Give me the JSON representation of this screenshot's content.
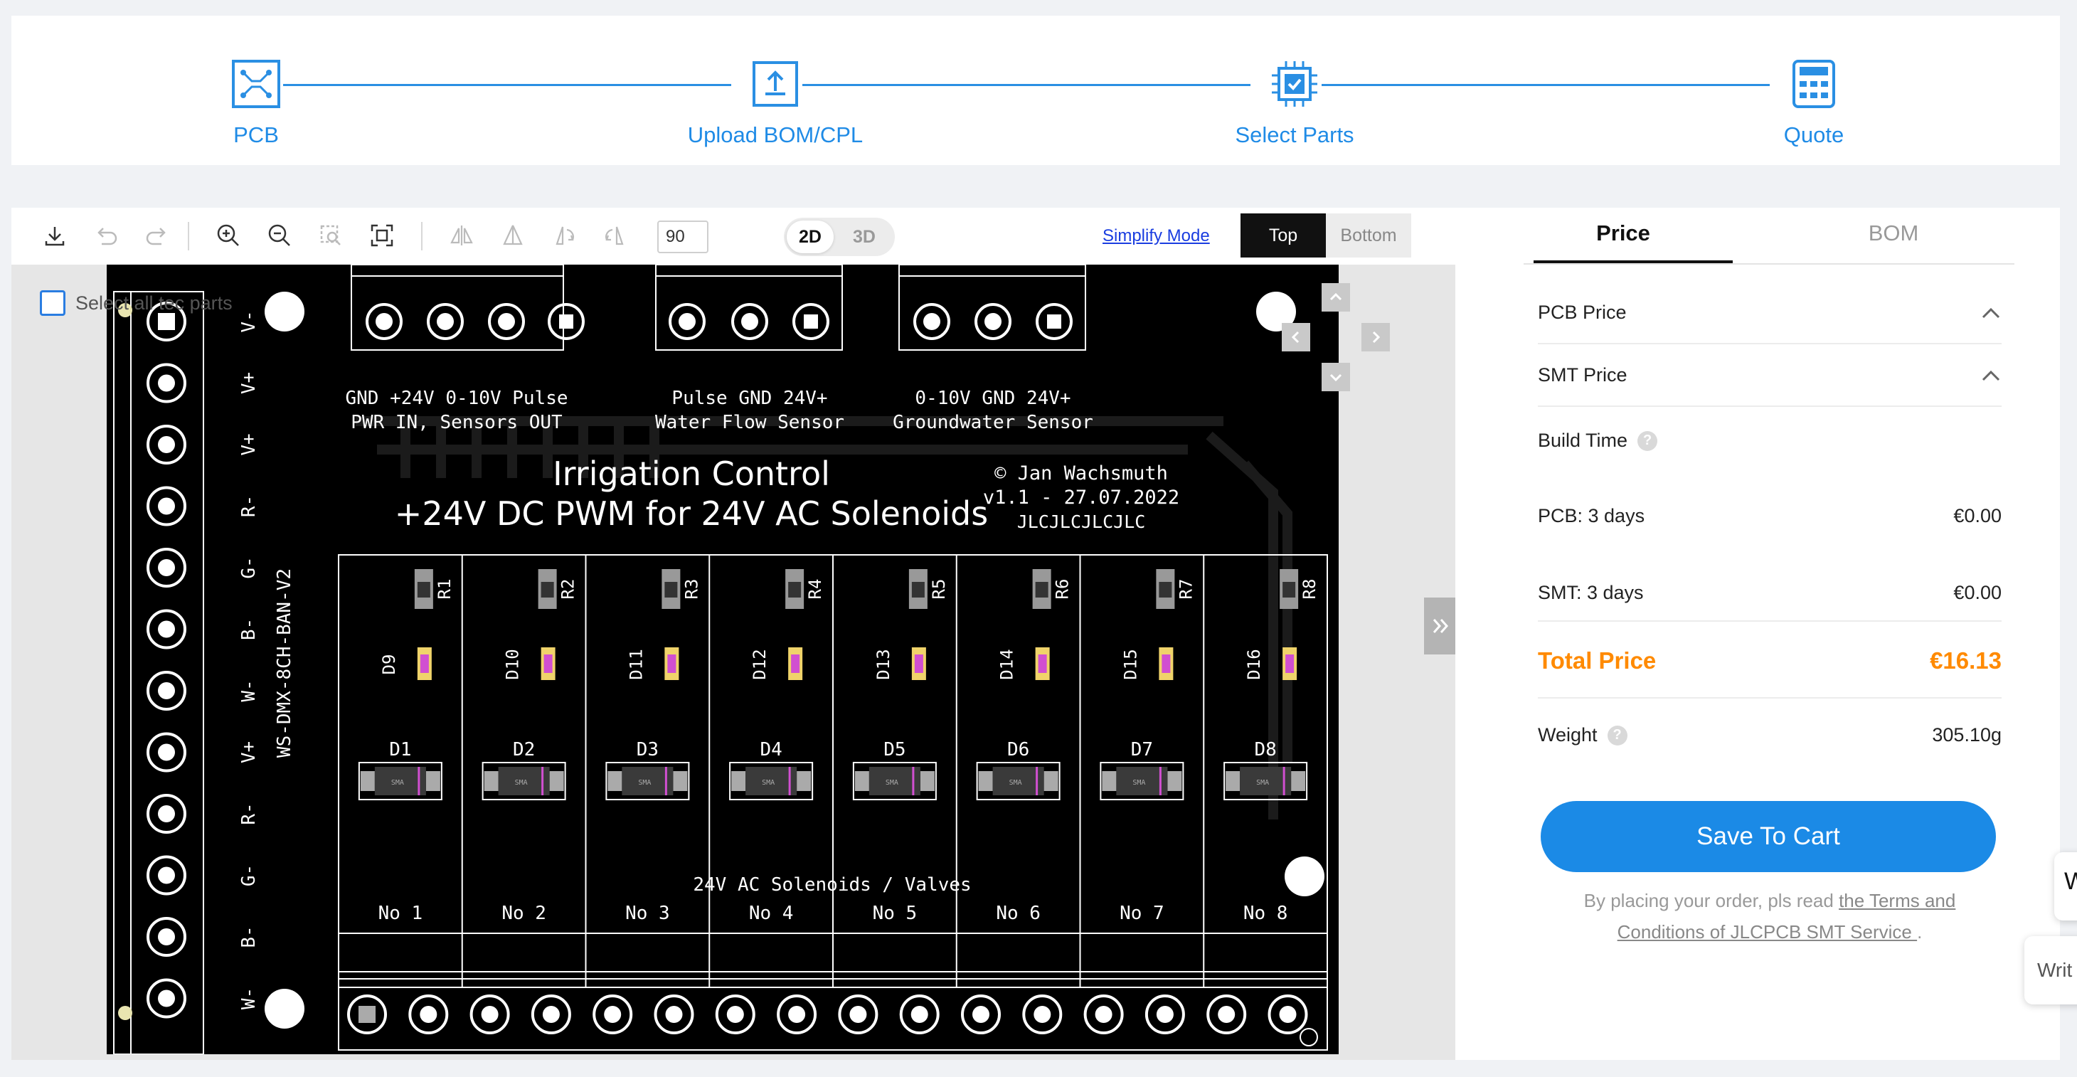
{
  "stepper": {
    "steps": [
      {
        "label": "PCB",
        "icon": "pcb-icon"
      },
      {
        "label": "Upload BOM/CPL",
        "icon": "upload-icon"
      },
      {
        "label": "Select Parts",
        "icon": "chip-icon"
      },
      {
        "label": "Quote",
        "icon": "calculator-icon"
      }
    ],
    "accent_color": "#1f8be6"
  },
  "toolbar": {
    "icons": [
      "download-icon",
      "undo-icon",
      "redo-icon",
      "zoom-in-icon",
      "zoom-out-icon",
      "zoom-area-icon",
      "fit-screen-icon",
      "flip-horizontal-icon",
      "flip-vertical-icon",
      "rotate-left-icon",
      "rotate-right-icon"
    ],
    "rotation_value": "90",
    "view_2d": "2D",
    "view_3d": "3D",
    "simplify_mode": "Simplify Mode",
    "side_top": "Top",
    "side_bottom": "Bottom"
  },
  "viewer": {
    "select_all_label": "Select all tec parts"
  },
  "pcb": {
    "terminal_1_labels": "GND  +24V  0-10V Pulse",
    "terminal_1_sub": "PWR IN, Sensors OUT",
    "terminal_2_labels": "Pulse  GND  24V+",
    "terminal_2_sub": "Water Flow Sensor",
    "terminal_3_labels": "0-10V  GND  24V+",
    "terminal_3_sub": "Groundwater Sensor",
    "title_line_1": "Irrigation Control",
    "title_line_2": "+24V DC PWM for 24V AC Solenoids",
    "author_line_1": "© Jan Wachsmuth",
    "author_line_2": "v1.1 - 27.07.2022",
    "author_line_3": "JLCJLCJLCJLC",
    "board_name": "WS-DMX-8CH-BAN-V2",
    "left_pin_labels": [
      "V-",
      "V+",
      "V+",
      "R-",
      "G-",
      "B-",
      "W-",
      "V+",
      "R-",
      "G-",
      "B-",
      "W-"
    ],
    "resistors": [
      "R1",
      "R2",
      "R3",
      "R4",
      "R5",
      "R6",
      "R7",
      "R8"
    ],
    "leds": [
      "D9",
      "D10",
      "D11",
      "D12",
      "D13",
      "D14",
      "D15",
      "D16"
    ],
    "diodes": [
      "D1",
      "D2",
      "D3",
      "D4",
      "D5",
      "D6",
      "D7",
      "D8"
    ],
    "diode_marking": "SMA",
    "solenoid_label": "24V AC Solenoids / Valves",
    "channels": [
      "No 1",
      "No 2",
      "No 3",
      "No 4",
      "No 5",
      "No 6",
      "No 7",
      "No 8"
    ]
  },
  "panel": {
    "tab_price": "Price",
    "tab_bom": "BOM",
    "pcb_price_label": "PCB Price",
    "smt_price_label": "SMT Price",
    "build_time_label": "Build Time",
    "pcb_days_label": "PCB: 3 days",
    "pcb_days_value": "€0.00",
    "smt_days_label": "SMT: 3 days",
    "smt_days_value": "€0.00",
    "total_label": "Total Price",
    "total_value": "€16.13",
    "total_color": "#ff8a00",
    "weight_label": "Weight",
    "weight_value": "305.10g",
    "save_button": "Save To Cart",
    "terms_prefix": "By placing your order, pls read ",
    "terms_link": "the Terms and Conditions of JLCPCB SMT Service ",
    "terms_suffix": ".",
    "help_glyph": "?"
  },
  "floating": {
    "widget_1": "W",
    "widget_2": "Writ"
  }
}
